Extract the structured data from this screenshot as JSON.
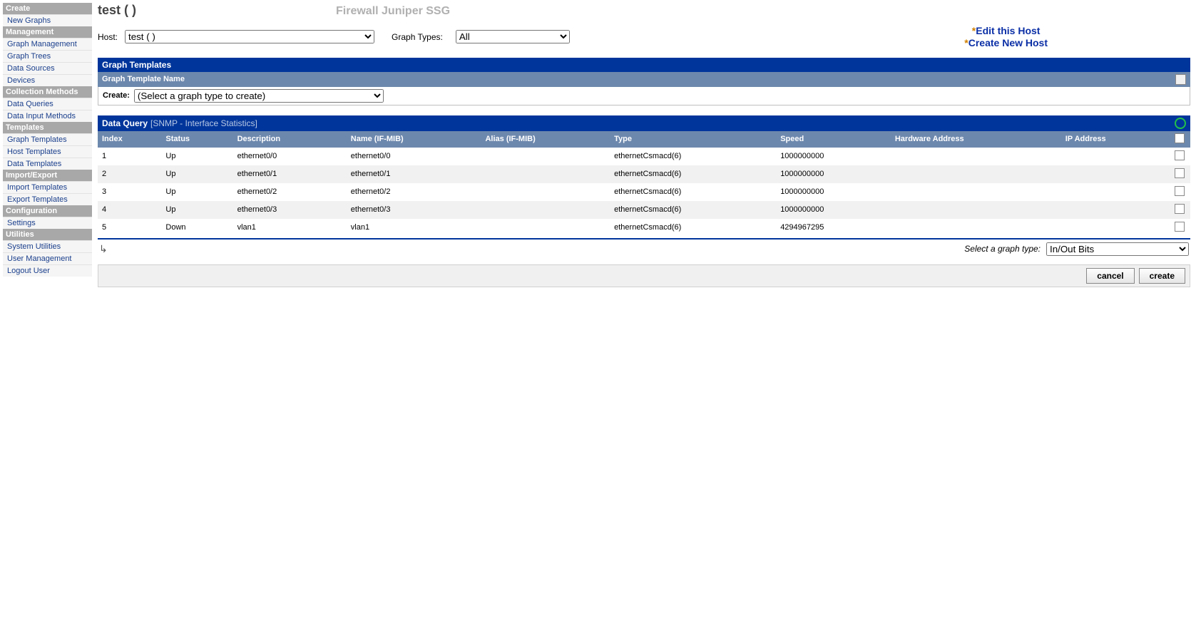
{
  "sidebar": {
    "sections": [
      {
        "title": "Create",
        "items": [
          "New Graphs"
        ]
      },
      {
        "title": "Management",
        "items": [
          "Graph Management",
          "Graph Trees",
          "Data Sources",
          "Devices"
        ]
      },
      {
        "title": "Collection Methods",
        "items": [
          "Data Queries",
          "Data Input Methods"
        ]
      },
      {
        "title": "Templates",
        "items": [
          "Graph Templates",
          "Host Templates",
          "Data Templates"
        ]
      },
      {
        "title": "Import/Export",
        "items": [
          "Import Templates",
          "Export Templates"
        ]
      },
      {
        "title": "Configuration",
        "items": [
          "Settings"
        ]
      },
      {
        "title": "Utilities",
        "items": [
          "System Utilities",
          "User Management",
          "Logout User"
        ]
      }
    ]
  },
  "header": {
    "title": "test (                  )",
    "subtitle": "Firewall Juniper SSG"
  },
  "filter": {
    "host_label": "Host:",
    "host_value": "test (                  )",
    "graph_types_label": "Graph Types:",
    "graph_types_value": "All"
  },
  "host_links": {
    "edit": "Edit this Host",
    "create": "Create New Host"
  },
  "graph_templates": {
    "bar_title": "Graph Templates",
    "sub_title": "Graph Template Name",
    "create_label": "Create:",
    "create_placeholder": "(Select a graph type to create)"
  },
  "data_query": {
    "label": "Data Query",
    "sub": "[SNMP - Interface Statistics]",
    "columns": [
      "Index",
      "Status",
      "Description",
      "Name (IF-MIB)",
      "Alias (IF-MIB)",
      "Type",
      "Speed",
      "Hardware Address",
      "IP Address"
    ],
    "rows": [
      {
        "index": "1",
        "status": "Up",
        "desc": "ethernet0/0",
        "name": "ethernet0/0",
        "alias": "",
        "type": "ethernetCsmacd(6)",
        "speed": "1000000000",
        "hw": "",
        "ip": ""
      },
      {
        "index": "2",
        "status": "Up",
        "desc": "ethernet0/1",
        "name": "ethernet0/1",
        "alias": "",
        "type": "ethernetCsmacd(6)",
        "speed": "1000000000",
        "hw": "",
        "ip": ""
      },
      {
        "index": "3",
        "status": "Up",
        "desc": "ethernet0/2",
        "name": "ethernet0/2",
        "alias": "",
        "type": "ethernetCsmacd(6)",
        "speed": "1000000000",
        "hw": "",
        "ip": ""
      },
      {
        "index": "4",
        "status": "Up",
        "desc": "ethernet0/3",
        "name": "ethernet0/3",
        "alias": "",
        "type": "ethernetCsmacd(6)",
        "speed": "1000000000",
        "hw": "",
        "ip": ""
      },
      {
        "index": "5",
        "status": "Down",
        "desc": "vlan1",
        "name": "vlan1",
        "alias": "",
        "type": "ethernetCsmacd(6)",
        "speed": "4294967295",
        "hw": "",
        "ip": ""
      }
    ]
  },
  "graph_type_select": {
    "label": "Select a graph type:",
    "value": "In/Out Bits"
  },
  "buttons": {
    "cancel": "cancel",
    "create": "create"
  }
}
